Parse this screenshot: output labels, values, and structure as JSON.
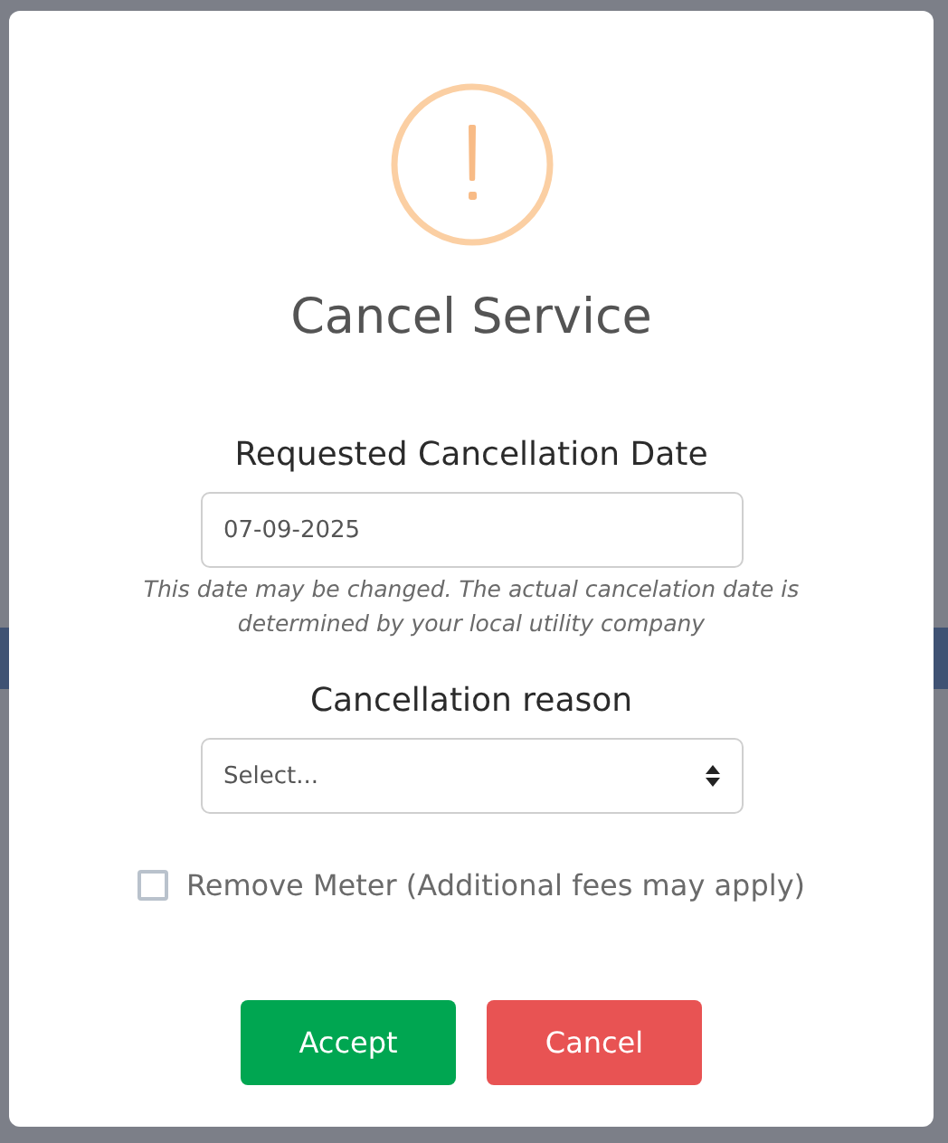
{
  "dialog": {
    "title": "Cancel Service",
    "date_field": {
      "label": "Requested Cancellation Date",
      "value": "07-09-2025",
      "hint": "This date may be changed. The actual cancelation date is determined by your local utility company"
    },
    "reason_field": {
      "label": "Cancellation reason",
      "placeholder": "Select..."
    },
    "remove_meter": {
      "label": "Remove Meter (Additional fees may apply)",
      "checked": false
    },
    "buttons": [
      {
        "label": "Accept",
        "kind": "accept"
      },
      {
        "label": "Cancel",
        "kind": "cancel"
      }
    ]
  }
}
